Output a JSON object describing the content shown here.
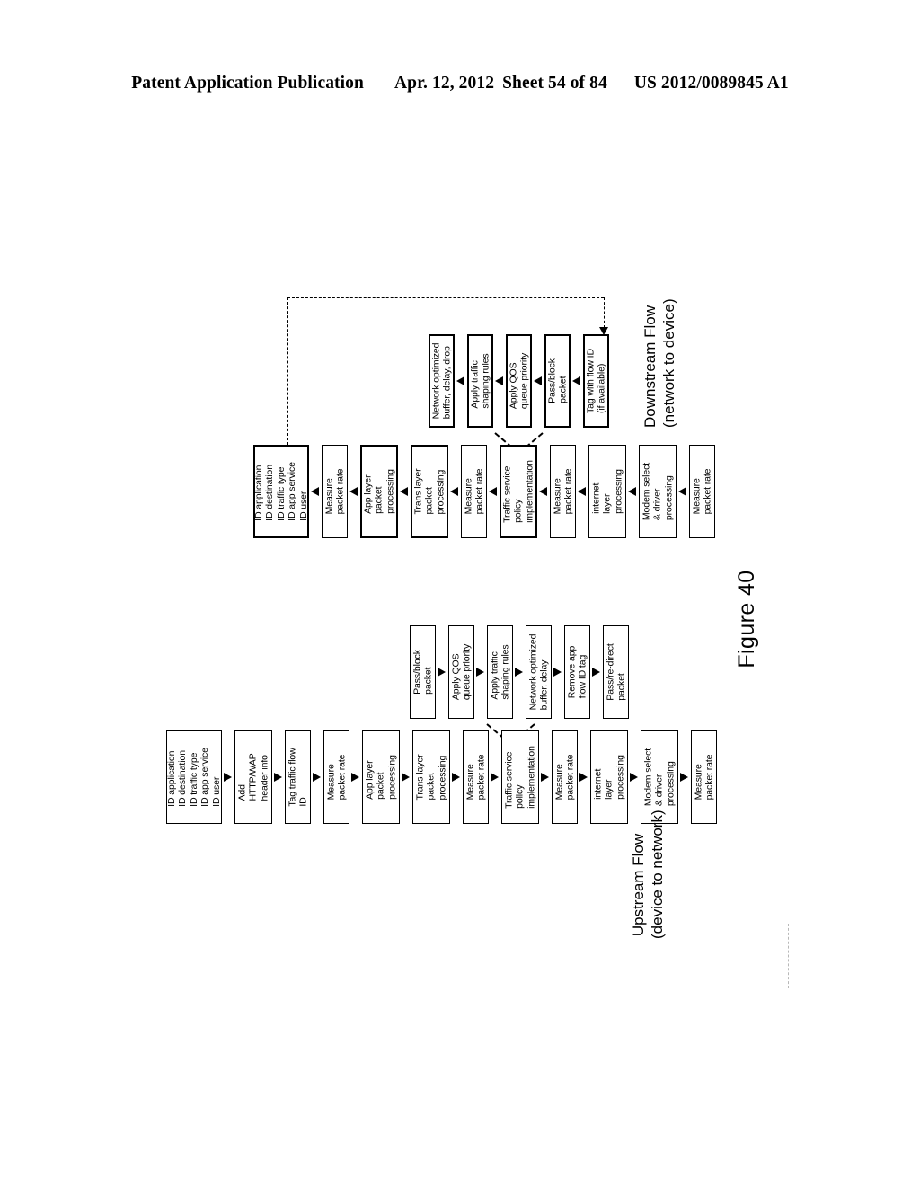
{
  "header": {
    "publication": "Patent Application Publication",
    "date": "Apr. 12, 2012",
    "sheet": "Sheet 54 of 84",
    "number": "US 2012/0089845 A1"
  },
  "figure": {
    "label": "Figure 40"
  },
  "downstream": {
    "caption_line1": "Downstream Flow",
    "caption_line2": "(network to device)",
    "qos_row": [
      {
        "id": "ds-network-optimized",
        "lines": [
          "Network optimized",
          "buffer, delay, drop"
        ]
      },
      {
        "id": "ds-apply-traffic-shaping",
        "lines": [
          "Apply traffic",
          "shaping rules"
        ]
      },
      {
        "id": "ds-apply-qos-queue",
        "lines": [
          "Apply QOS",
          "queue priority"
        ]
      },
      {
        "id": "ds-pass-block-packet",
        "lines": [
          "Pass/block",
          "packet"
        ]
      },
      {
        "id": "ds-tag-with-flow-id",
        "lines": [
          "Tag with flow ID",
          "(if available)"
        ]
      }
    ],
    "main_row": [
      {
        "id": "ds-id-application",
        "lines": [
          "ID application",
          "ID destination",
          "ID traffic type",
          "ID app service",
          "ID user"
        ]
      },
      {
        "id": "ds-measure-packet-rate-1",
        "lines": [
          "Measure",
          "packet rate"
        ]
      },
      {
        "id": "ds-app-layer-packet-processing",
        "lines": [
          "App layer",
          "packet",
          "processing"
        ]
      },
      {
        "id": "ds-trans-layer-packet-processing",
        "lines": [
          "Trans layer",
          "packet",
          "processing"
        ]
      },
      {
        "id": "ds-measure-packet-rate-2",
        "lines": [
          "Measure",
          "packet rate"
        ]
      },
      {
        "id": "ds-traffic-service-policy",
        "lines": [
          "Traffic service",
          "policy",
          "implementation"
        ]
      },
      {
        "id": "ds-measure-packet-rate-3",
        "lines": [
          "Measure",
          "packet rate"
        ]
      },
      {
        "id": "ds-internet-layer-processing",
        "lines": [
          "internet",
          "layer",
          "processing"
        ]
      },
      {
        "id": "ds-modem-select-driver",
        "lines": [
          "Modem select",
          "& driver",
          "processing"
        ]
      },
      {
        "id": "ds-measure-packet-rate-4",
        "lines": [
          "Measure",
          "packet rate"
        ]
      }
    ]
  },
  "upstream": {
    "caption_line1": "Upstream Flow",
    "caption_line2": "(device to network)",
    "qos_row": [
      {
        "id": "us-pass-block-packet",
        "lines": [
          "Pass/block",
          "packet"
        ]
      },
      {
        "id": "us-apply-qos-queue",
        "lines": [
          "Apply QOS",
          "queue priority"
        ]
      },
      {
        "id": "us-apply-traffic-shaping",
        "lines": [
          "Apply traffic",
          "shaping rules"
        ]
      },
      {
        "id": "us-network-optimized",
        "lines": [
          "Network optimized",
          "buffer, delay"
        ]
      },
      {
        "id": "us-remove-app-flow-id-tag",
        "lines": [
          "Remove app",
          "flow ID tag"
        ]
      },
      {
        "id": "us-pass-redirect-packet",
        "lines": [
          "Pass/re-direct",
          "packet"
        ]
      }
    ],
    "main_row": [
      {
        "id": "us-id-application",
        "lines": [
          "ID application",
          "ID destination",
          "ID traffic type",
          "ID app service",
          "ID user"
        ]
      },
      {
        "id": "us-add-http-wap-header",
        "lines": [
          "Add",
          "HTTP/WAP",
          "header info"
        ]
      },
      {
        "id": "us-tag-traffic-flow-id",
        "lines": [
          "Tag traffic flow",
          "ID"
        ]
      },
      {
        "id": "us-measure-packet-rate-1",
        "lines": [
          "Measure",
          "packet rate"
        ]
      },
      {
        "id": "us-app-layer-packet-processing",
        "lines": [
          "App layer",
          "packet",
          "processing"
        ]
      },
      {
        "id": "us-trans-layer-packet-processing",
        "lines": [
          "Trans layer",
          "packet",
          "processing"
        ]
      },
      {
        "id": "us-measure-packet-rate-2",
        "lines": [
          "Measure",
          "packet rate"
        ]
      },
      {
        "id": "us-traffic-service-policy",
        "lines": [
          "Traffic service",
          "policy",
          "implementation"
        ]
      },
      {
        "id": "us-measure-packet-rate-3",
        "lines": [
          "Measure",
          "packet rate"
        ]
      },
      {
        "id": "us-internet-layer-processing",
        "lines": [
          "internet",
          "layer",
          "processing"
        ]
      },
      {
        "id": "us-modem-select-driver",
        "lines": [
          "Modem select",
          "& driver",
          "processing"
        ]
      },
      {
        "id": "us-measure-packet-rate-4",
        "lines": [
          "Measure",
          "packet rate"
        ]
      }
    ]
  }
}
